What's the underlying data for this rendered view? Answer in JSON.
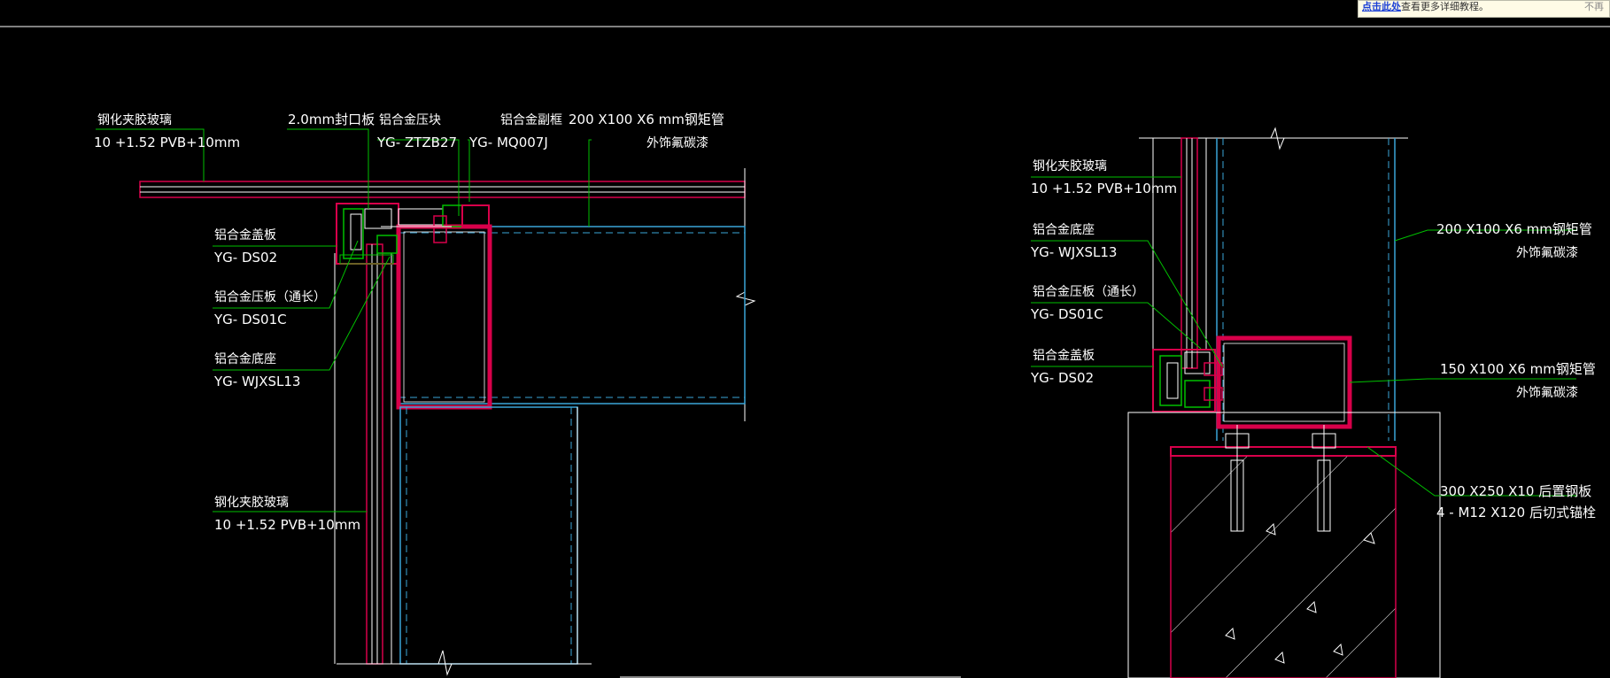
{
  "notice": {
    "link": "点击此处",
    "text": "查看更多详细教程。",
    "close": "不再"
  },
  "colors": {
    "background": "#000000",
    "text": "#ffffff",
    "leader": "#00c000",
    "steel": "#d8004a",
    "profile": "#ffffff",
    "blue": "#3aa6d8"
  },
  "left_detail": {
    "glass_top": {
      "name": "钢化夹胶玻璃",
      "spec": "10 +1.52 PVB+10mm"
    },
    "seal_plate": {
      "name": "2.0mm封口板"
    },
    "pressure_block": {
      "name": "铝合金压块",
      "code": "YG- ZTZB27"
    },
    "sub_frame": {
      "name": "铝合金副框",
      "code": "YG- MQ007J"
    },
    "steel_tube": {
      "name": "200 X100 X6 mm钢矩管",
      "finish": "外饰氟碳漆"
    },
    "cover_plate": {
      "name": "铝合金盖板",
      "code": "YG- DS02"
    },
    "press_plate": {
      "name": "铝合金压板（通长）",
      "code": "YG- DS01C"
    },
    "base": {
      "name": "铝合金底座",
      "code": "YG- WJXSL13"
    },
    "glass_vertical": {
      "name": "钢化夹胶玻璃",
      "spec": "10 +1.52 PVB+10mm"
    }
  },
  "right_detail": {
    "glass": {
      "name": "钢化夹胶玻璃",
      "spec": "10 +1.52 PVB+10mm"
    },
    "base": {
      "name": "铝合金底座",
      "code": "YG- WJXSL13"
    },
    "press_plate": {
      "name": "铝合金压板（通长）",
      "code": "YG- DS01C"
    },
    "cover_plate": {
      "name": "铝合金盖板",
      "code": "YG- DS02"
    },
    "steel_tube_large": {
      "name": "200 X100 X6 mm钢矩管",
      "finish": "外饰氟碳漆"
    },
    "steel_tube_small": {
      "name": "150 X100 X6 mm钢矩管",
      "finish": "外饰氟碳漆"
    },
    "embed_plate": {
      "name": "300 X250 X10 后置钢板",
      "bolts": "4 - M12 X120 后切式锚栓"
    }
  }
}
